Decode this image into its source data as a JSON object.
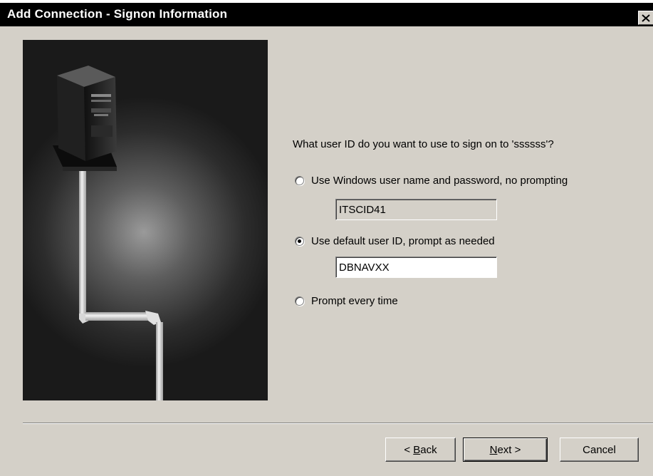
{
  "window": {
    "title": "Add Connection - Signon Information",
    "close_icon": "close-icon"
  },
  "illustration": {
    "description_icon": "server-tower-icon"
  },
  "prompt": {
    "question": "What user ID do you want to use to sign on to 'ssssss'?"
  },
  "options": [
    {
      "label": "Use Windows user name and password, no prompting",
      "selected": false,
      "field_value": "ITSCID41",
      "field_enabled": false
    },
    {
      "label": "Use default user ID, prompt as needed",
      "selected": true,
      "field_value": "DBNAVXX",
      "field_enabled": true
    },
    {
      "label": "Prompt every time",
      "selected": false
    }
  ],
  "buttons": {
    "back_prefix": "< ",
    "back_mnemonic": "B",
    "back_rest": "ack",
    "next_mnemonic": "N",
    "next_rest": "ext >",
    "cancel": "Cancel"
  },
  "colors": {
    "dialog_bg": "#d4d0c8",
    "titlebar_bg": "#000000",
    "illustration_bg": "#1a1a1a"
  }
}
